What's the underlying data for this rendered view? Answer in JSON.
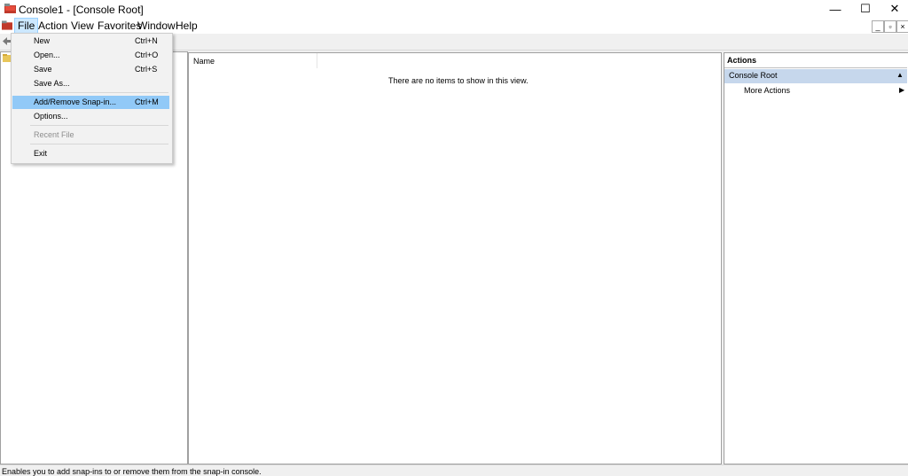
{
  "window": {
    "title": "Console1 - [Console Root]",
    "minimize_glyph": "—",
    "maximize_glyph": "☐",
    "close_glyph": "✕"
  },
  "menubar": {
    "items": [
      "File",
      "Action",
      "View",
      "Favorites",
      "Window",
      "Help"
    ]
  },
  "mdi_controls": {
    "minimize": "_",
    "restore": "▫",
    "close": "×"
  },
  "file_menu": {
    "items": [
      {
        "label": "New",
        "shortcut": "Ctrl+N",
        "state": "normal"
      },
      {
        "label": "Open...",
        "shortcut": "Ctrl+O",
        "state": "normal"
      },
      {
        "label": "Save",
        "shortcut": "Ctrl+S",
        "state": "normal"
      },
      {
        "label": "Save As...",
        "shortcut": "",
        "state": "normal"
      },
      {
        "label": "Add/Remove Snap-in...",
        "shortcut": "Ctrl+M",
        "state": "highlighted"
      },
      {
        "label": "Options...",
        "shortcut": "",
        "state": "normal"
      },
      {
        "label": "Recent File",
        "shortcut": "",
        "state": "disabled"
      },
      {
        "label": "Exit",
        "shortcut": "",
        "state": "normal"
      }
    ]
  },
  "list_view": {
    "column_name": "Name",
    "empty_message": "There are no items to show in this view."
  },
  "actions_pane": {
    "title": "Actions",
    "section": "Console Root",
    "more_actions": "More Actions"
  },
  "statusbar": {
    "text": "Enables you to add snap-ins to or remove them from the snap-in console."
  },
  "icons": {
    "app": "mmc-console-icon",
    "back": "back-arrow-icon",
    "folder": "folder-icon"
  },
  "colors": {
    "menu_highlight": "#91c9f7",
    "file_menu_active": "#cce8ff",
    "actions_header": "#c6d7ec"
  }
}
